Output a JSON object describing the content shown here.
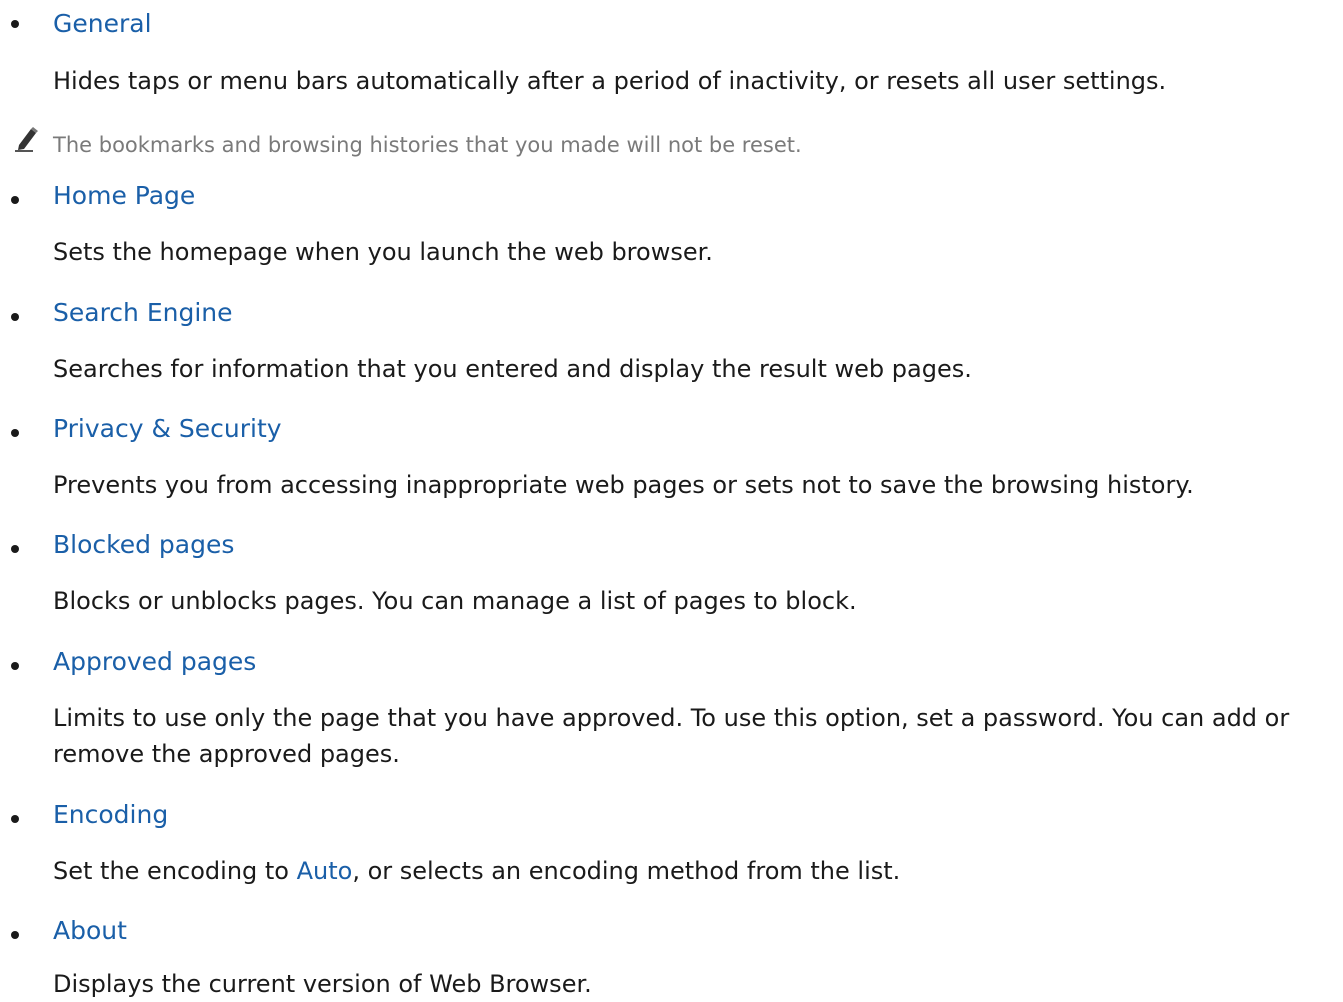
{
  "items": [
    {
      "title": "General",
      "description": "Hides taps or menu bars automatically after a period of inactivity, or resets all user settings.",
      "note": "The bookmarks and browsing histories that you made will not be reset."
    },
    {
      "title": "Home Page",
      "description": "Sets the homepage when you launch the web browser."
    },
    {
      "title": "Search Engine",
      "description": "Searches for information that you entered and display the result web pages."
    },
    {
      "title": "Privacy & Security",
      "description": "Prevents you from accessing inappropriate web pages or sets not to save the browsing history."
    },
    {
      "title": "Blocked pages",
      "description": "Blocks or unblocks pages. You can manage a list of pages to block."
    },
    {
      "title": "Approved pages",
      "description": "Limits to use only the page that you have approved. To use this option, set a password. You can add or remove the approved pages."
    },
    {
      "title": "Encoding",
      "description_before": "Set the encoding to ",
      "description_highlight": "Auto",
      "description_after": ", or selects an encoding method from the list."
    },
    {
      "title": "About",
      "description": "Displays the current version of Web Browser."
    }
  ],
  "icons": {
    "note": "pencil-icon"
  },
  "colors": {
    "heading": "#1a5fa8",
    "body_text": "#1a1a1a",
    "note_text": "#7a7a7a"
  }
}
